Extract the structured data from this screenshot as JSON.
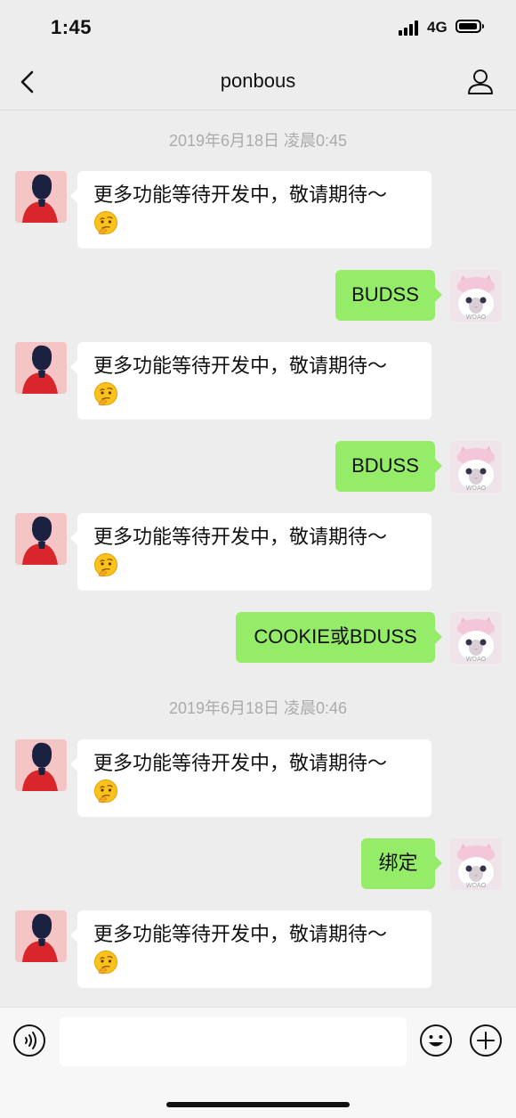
{
  "status_bar": {
    "time": "1:45",
    "network": "4G"
  },
  "nav": {
    "title": "ponbous",
    "back_icon": "chevron-left-icon",
    "profile_icon": "person-icon"
  },
  "chat": {
    "timestamps": [
      "2019年6月18日 凌晨0:45",
      "2019年6月18日 凌晨0:46"
    ],
    "bot_reply": "更多功能等待开发中，敬请期待～",
    "bot_emoji": "thinking-face-icon",
    "outgoing": [
      "BUDSS",
      "BDUSS",
      "COOKIE或BDUSS",
      "绑定"
    ],
    "watermark": "WOAO"
  },
  "input": {
    "placeholder": "",
    "value": ""
  },
  "colors": {
    "outgoing_bubble": "#95ec69",
    "incoming_bubble": "#ffffff",
    "background": "#ededed"
  }
}
